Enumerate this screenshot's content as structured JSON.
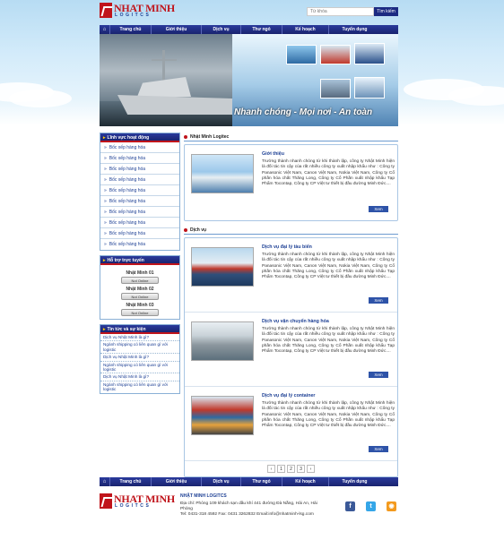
{
  "brand": {
    "name": "NHAT MINH",
    "sub": "LOGITCS"
  },
  "search": {
    "placeholder": "Từ khóa",
    "button": "Tìm kiếm"
  },
  "nav": {
    "home_icon": "home-icon",
    "items": [
      "Trang chủ",
      "Giới thiệu",
      "Dịch vụ",
      "Thư ngỏ",
      "Kế hoạch",
      "Tuyển dụng"
    ]
  },
  "banner": {
    "slogan": "Nhanh chóng - Mọi nơi - An toàn"
  },
  "sidebar": {
    "activities": {
      "title": "Lĩnh vực hoạt động",
      "items": [
        "Bốc xếp hàng hóa",
        "Bốc xếp hàng hóa",
        "Bốc xếp hàng hóa",
        "Bốc xếp hàng hóa",
        "Bốc xếp hàng hóa",
        "Bốc xếp hàng hóa",
        "Bốc xếp hàng hóa",
        "Bốc xếp hàng hóa",
        "Bốc xếp hàng hóa",
        "Bốc xếp hàng hóa"
      ]
    },
    "support": {
      "title": "Hỗ trợ trực tuyến",
      "people": [
        "Nhật Minh 01",
        "Nhật Minh 02",
        "Nhật Minh 03"
      ],
      "status": "Not Online"
    },
    "news": {
      "title": "Tin tức và sự kiện",
      "items": [
        "Dịch vụ Nhật Minh là gì?",
        "Ngành shipping có liên quan gì với logistic",
        "Dịch vụ Nhật Minh là gì?",
        "Ngành shipping có liên quan gì với logistic",
        "Dịch vụ Nhật Minh là gì?",
        "Ngành shipping có liên quan gì với logistic"
      ]
    }
  },
  "main": {
    "section1": "Nhật Minh Logitec",
    "intro": {
      "title": "Giới thiệu",
      "desc": "Trưởng thành nhanh chóng từ khi thành lập, công ty Nhật Minh hiện là đối tác tin cậy của rất nhiều công ty xuất nhập khẩu như : Công ty Panasonic Việt Nam, Canon Việt Nam, Nokia Việt Nam, Công ty Cổ phần hóa chất Thăng Long, Công ty Cổ Phần xuất nhập khẩu Tạp Phẩm Tocontap, Công ty CP Việt tư thiết bị đầu đường Minh Đức....",
      "more": "Xem"
    },
    "section2": "Dịch vụ",
    "services": [
      {
        "title": "Dịch vụ đại lý tàu biển",
        "desc": "Trưởng thành nhanh chóng từ khi thành lập, công ty Nhật Minh hiện là đối tác tin cậy của rất nhiều công ty xuất nhập khẩu như : Công ty Panasonic Việt Nam, Canon Việt Nam, Nokia Việt Nam, Công ty Cổ phần hóa chất Thăng Long, Công ty Cổ Phần xuất nhập khẩu Tạp Phẩm Tocontap, Công ty CP Việt tư thiết bị đầu đường Minh Đức....",
        "more": "Xem"
      },
      {
        "title": "Dịch vụ vận chuyển hàng hóa",
        "desc": "Trưởng thành nhanh chóng từ khi thành lập, công ty Nhật Minh hiện là đối tác tin cậy của rất nhiều công ty xuất nhập khẩu như : Công ty Panasonic Việt Nam, Canon Việt Nam, Nokia Việt Nam, Công ty Cổ phần hóa chất Thăng Long, Công ty Cổ Phần xuất nhập khẩu Tạp Phẩm Tocontap, Công ty CP Việt tư thiết bị đầu đường Minh Đức....",
        "more": "Xem"
      },
      {
        "title": "Dịch vụ đại lý container",
        "desc": "Trưởng thành nhanh chóng từ khi thành lập, công ty Nhật Minh hiện là đối tác tin cậy của rất nhiều công ty xuất nhập khẩu như : Công ty Panasonic Việt Nam, Canon Việt Nam, Nokia Việt Nam, Công ty Cổ phần hóa chất Thăng Long, Công ty Cổ Phần xuất nhập khẩu Tạp Phẩm Tocontap, Công ty CP Việt tư thiết bị đầu đường Minh Đức....",
        "more": "Xem"
      }
    ],
    "pager": [
      "‹",
      "1",
      "2",
      "3",
      "›"
    ]
  },
  "footer": {
    "company": "NHẬT MINH LOGITCS",
    "address": "Địa chỉ: Phòng 109 khách sạn dầu khí 441 đường Đà Nẵng, Hải An, Hải Phòng",
    "contact": "Tel: 0431-318 4592 Fax: 0431 3262832 Email:info@nhatminh-lsg.com",
    "social": [
      "facebook-icon",
      "twitter-icon",
      "rss-icon"
    ]
  },
  "colors": {
    "brand_red": "#c0141b",
    "nav_blue": "#1a2470",
    "link_blue": "#1c3f94"
  }
}
